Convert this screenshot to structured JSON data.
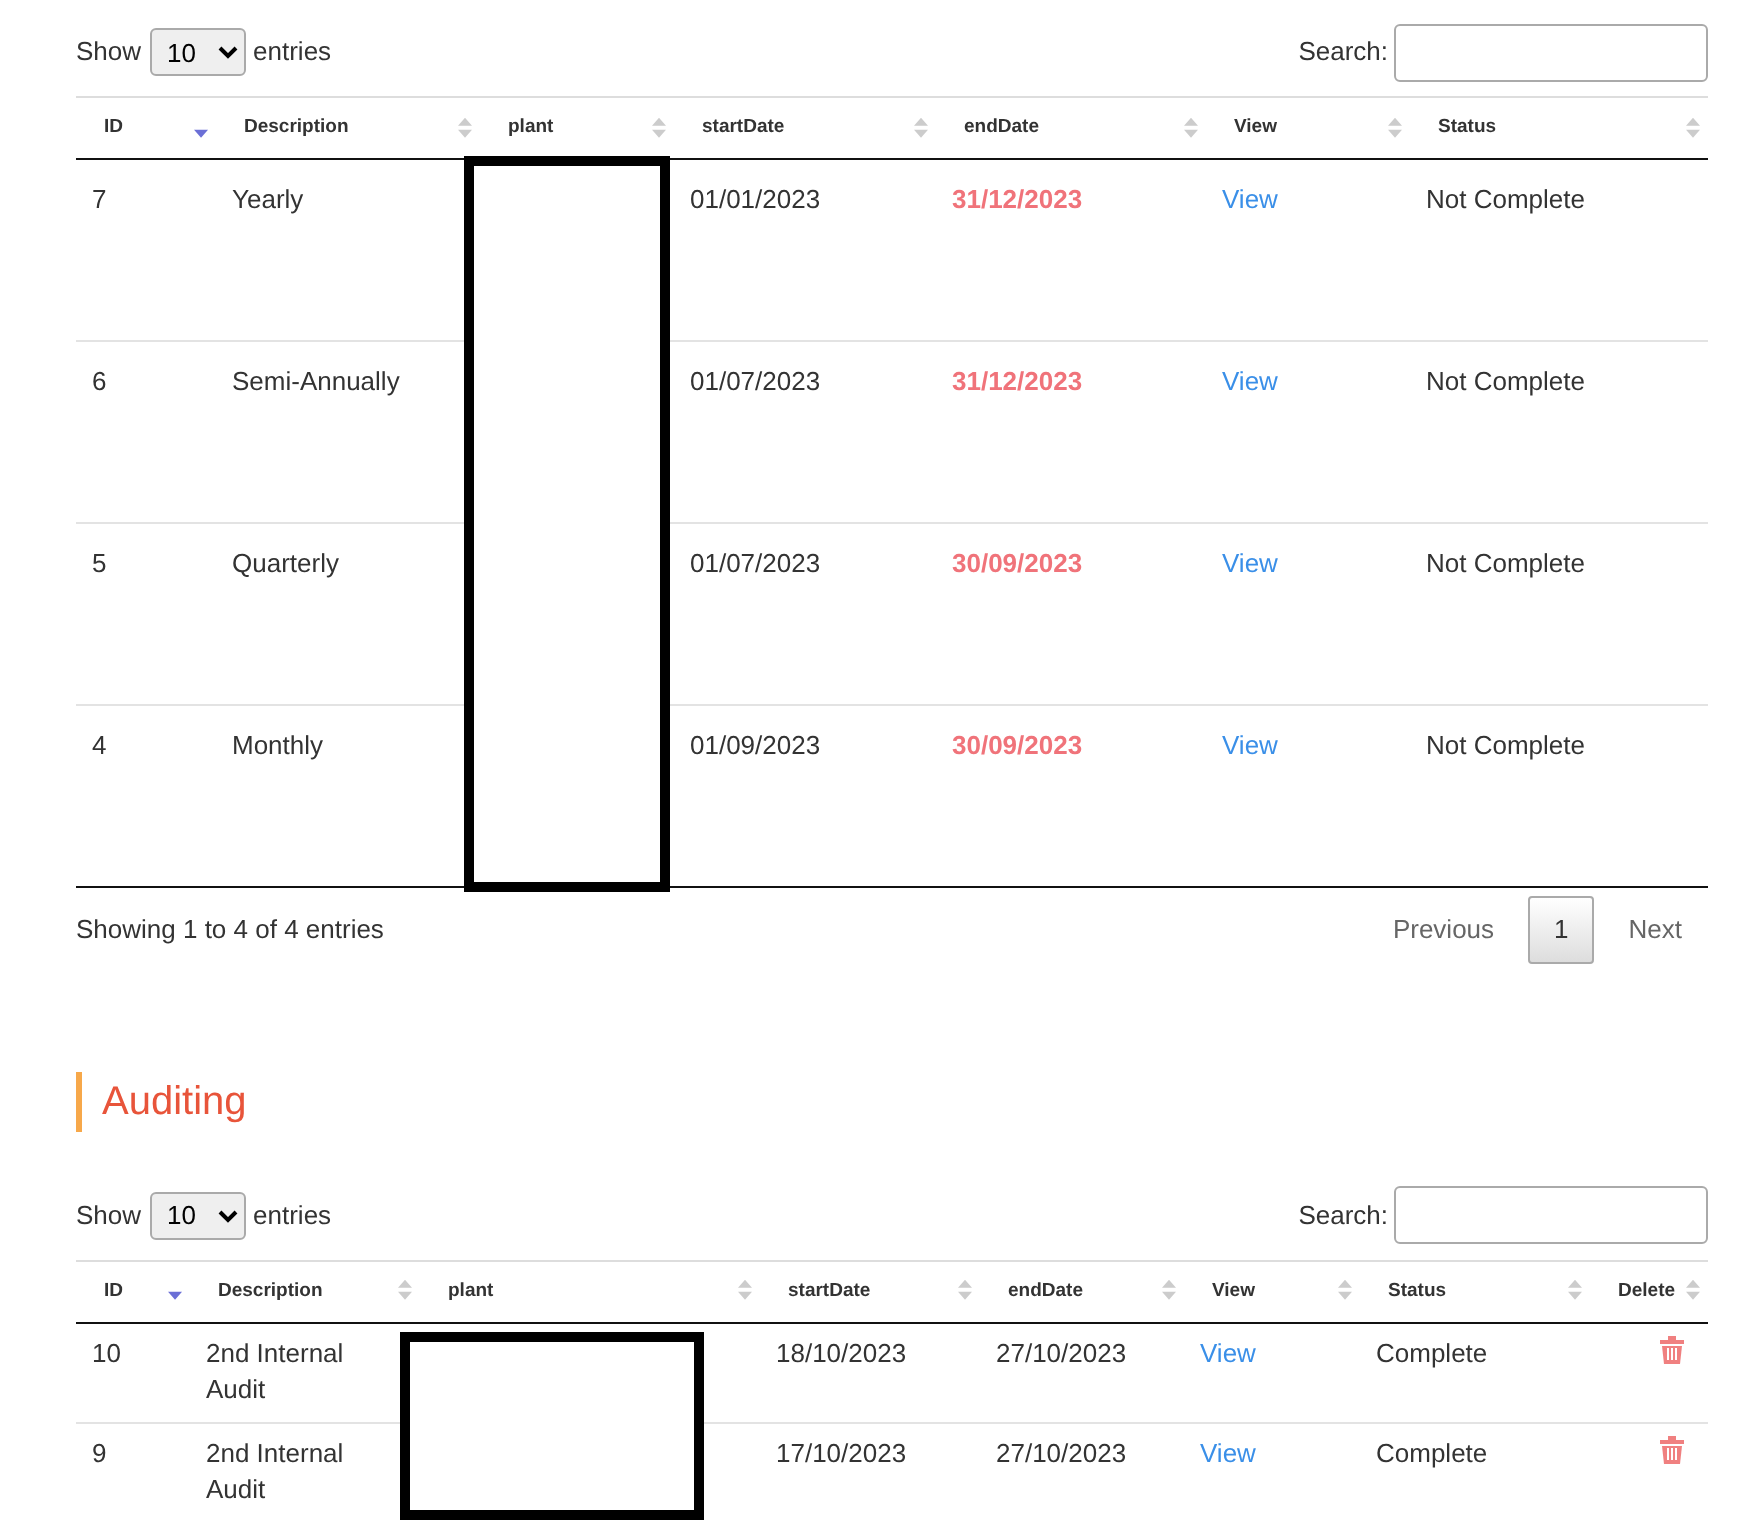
{
  "tables": [
    {
      "length": {
        "prefix": "Show",
        "value": "10",
        "suffix": "entries"
      },
      "search": {
        "label": "Search:"
      },
      "columns": [
        {
          "label": "ID",
          "kind": "id",
          "sorted": true
        },
        {
          "label": "Description",
          "kind": "description",
          "sorted": false
        },
        {
          "label": "plant",
          "kind": "plant",
          "sorted": false
        },
        {
          "label": "startDate",
          "kind": "start",
          "sorted": false
        },
        {
          "label": "endDate",
          "kind": "end",
          "sorted": false
        },
        {
          "label": "View",
          "kind": "view",
          "sorted": false
        },
        {
          "label": "Status",
          "kind": "status",
          "sorted": false
        }
      ],
      "rows": [
        {
          "id": "7",
          "description": "Yearly",
          "start_date": "01/01/2023",
          "end_date": "31/12/2023",
          "overdue": true,
          "view": "View",
          "status": "Not Complete"
        },
        {
          "id": "6",
          "description": "Semi-Annually",
          "start_date": "01/07/2023",
          "end_date": "31/12/2023",
          "overdue": true,
          "view": "View",
          "status": "Not Complete"
        },
        {
          "id": "5",
          "description": "Quarterly",
          "start_date": "01/07/2023",
          "end_date": "30/09/2023",
          "overdue": true,
          "view": "View",
          "status": "Not Complete"
        },
        {
          "id": "4",
          "description": "Monthly",
          "start_date": "01/09/2023",
          "end_date": "30/09/2023",
          "overdue": true,
          "view": "View",
          "status": "Not Complete"
        }
      ],
      "info": "Showing 1 to 4 of 4 entries",
      "pagination": [
        {
          "label": "Previous",
          "selected": false
        },
        {
          "label": "1",
          "selected": true
        },
        {
          "label": "Next",
          "selected": false
        }
      ]
    },
    {
      "heading": "Auditing",
      "length": {
        "prefix": "Show",
        "value": "10",
        "suffix": "entries"
      },
      "search": {
        "label": "Search:"
      },
      "columns": [
        {
          "label": "ID",
          "kind": "id",
          "sorted": true
        },
        {
          "label": "Description",
          "kind": "description",
          "sorted": false
        },
        {
          "label": "plant",
          "kind": "plant",
          "sorted": false
        },
        {
          "label": "startDate",
          "kind": "start",
          "sorted": false
        },
        {
          "label": "endDate",
          "kind": "end",
          "sorted": false
        },
        {
          "label": "View",
          "kind": "view",
          "sorted": false
        },
        {
          "label": "Status",
          "kind": "status",
          "sorted": false
        },
        {
          "label": "Delete",
          "kind": "delete",
          "sorted": false
        }
      ],
      "rows": [
        {
          "id": "10",
          "description": "2nd Internal Audit",
          "start_date": "18/10/2023",
          "end_date": "27/10/2023",
          "overdue": false,
          "view": "View",
          "status": "Complete"
        },
        {
          "id": "9",
          "description": "2nd Internal Audit",
          "start_date": "17/10/2023",
          "end_date": "27/10/2023",
          "overdue": false,
          "view": "View",
          "status": "Complete"
        }
      ]
    }
  ]
}
